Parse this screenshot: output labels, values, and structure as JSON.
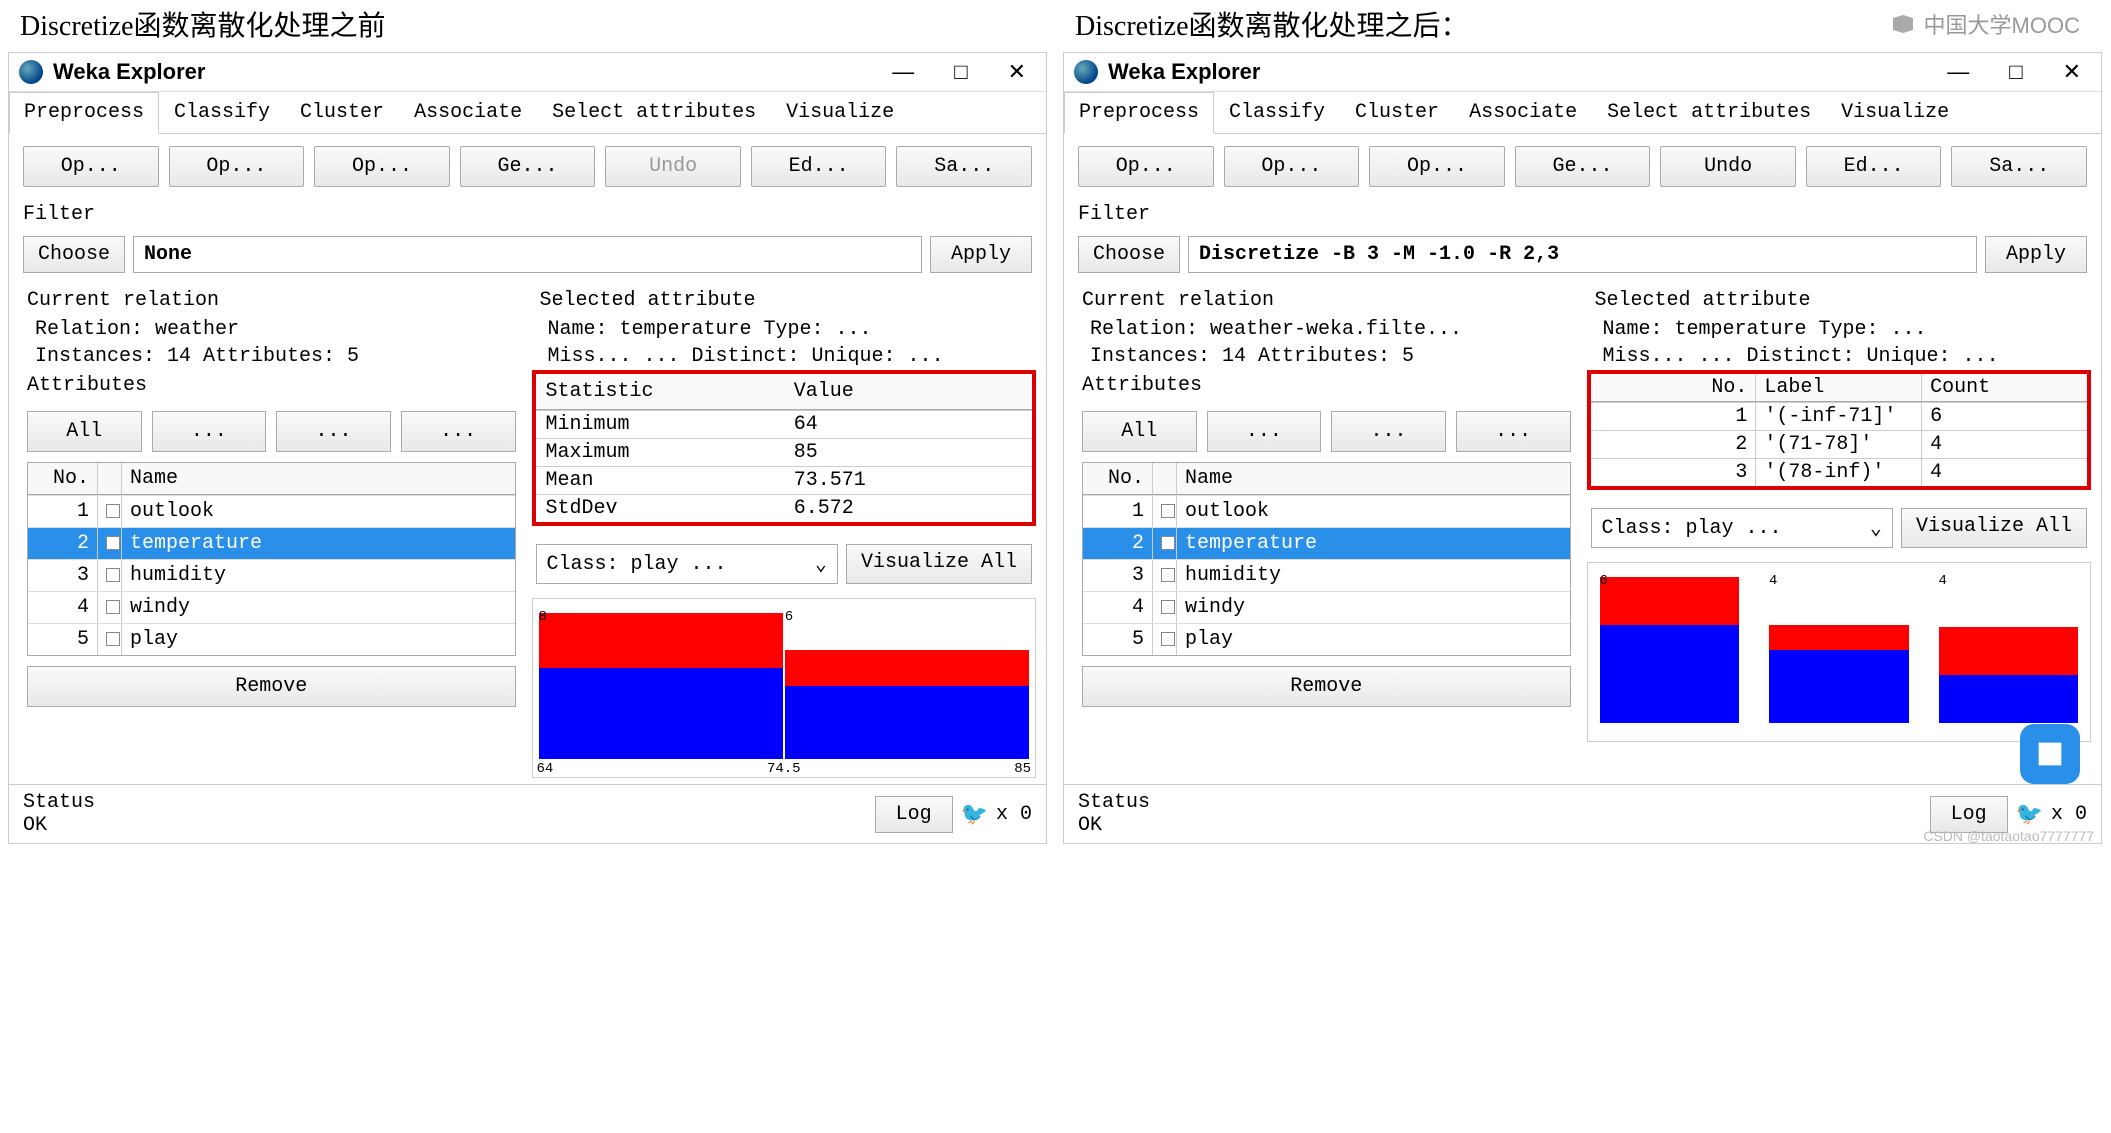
{
  "page_titles": {
    "before": "Discretize函数离散化处理之前",
    "after": "Discretize函数离散化处理之后：",
    "mooc": "中国大学MOOC"
  },
  "watermark": "CSDN @taotaotao7777777",
  "window_title": "Weka Explorer",
  "win_buttons": {
    "min": "—",
    "max": "□",
    "close": "✕"
  },
  "tabs": [
    "Preprocess",
    "Classify",
    "Cluster",
    "Associate",
    "Select attributes",
    "Visualize"
  ],
  "toolbar": [
    "Op...",
    "Op...",
    "Op...",
    "Ge...",
    "Undo",
    "Ed...",
    "Sa..."
  ],
  "filter_label": "Filter",
  "choose_label": "Choose",
  "apply_label": "Apply",
  "filter_value_before": "None",
  "filter_value_after": "Discretize -B 3 -M -1.0 -R 2,3",
  "relation_title": "Current relation",
  "relation_before": "Relation: weather",
  "relation_after": "Relation: weather-weka.filte...",
  "instances_line": "Instances: 14    Attributes: 5",
  "attributes_title": "Attributes",
  "attr_btns": [
    "All",
    "...",
    "...",
    "..."
  ],
  "attr_header": {
    "no": "No.",
    "name": "Name"
  },
  "attributes": [
    {
      "no": 1,
      "name": "outlook"
    },
    {
      "no": 2,
      "name": "temperature",
      "selected": true
    },
    {
      "no": 3,
      "name": "humidity"
    },
    {
      "no": 4,
      "name": "windy"
    },
    {
      "no": 5,
      "name": "play"
    }
  ],
  "remove_label": "Remove",
  "selected_attr_title": "Selected attribute",
  "selected_lines": [
    "Name: temperature     Type: ...",
    "Miss... ...  Distinct:  Unique: ..."
  ],
  "stat_header_before": [
    "Statistic",
    "Value"
  ],
  "stats_before": [
    [
      "Minimum",
      "64"
    ],
    [
      "Maximum",
      "85"
    ],
    [
      "Mean",
      "73.571"
    ],
    [
      "StdDev",
      "6.572"
    ]
  ],
  "stat_header_after": [
    "No.",
    "Label",
    "Count"
  ],
  "stats_after": [
    [
      "1",
      "'(-inf-71]'",
      "6"
    ],
    [
      "2",
      "'(71-78]'",
      "4"
    ],
    [
      "3",
      "'(78-inf)'",
      "4"
    ]
  ],
  "class_select": "Class: play ...",
  "visualize_all": "Visualize All",
  "chart_data": [
    {
      "type": "bar",
      "title": "",
      "x": [
        64,
        74.5,
        85
      ],
      "x_ticks": [
        "64",
        "74.5",
        "85"
      ],
      "bars": [
        {
          "label": "8",
          "total": 8,
          "blue": 5,
          "red": 3
        },
        {
          "label": "6",
          "total": 6,
          "blue": 4,
          "red": 2
        }
      ]
    },
    {
      "type": "bar",
      "title": "",
      "categories": [
        "'(-inf-71]'",
        "'(71-78]'",
        "'(78-inf)'"
      ],
      "bars": [
        {
          "label": "6",
          "total": 6,
          "blue": 4,
          "red": 2
        },
        {
          "label": "4",
          "total": 4,
          "blue": 3,
          "red": 1
        },
        {
          "label": "4",
          "total": 4,
          "blue": 2,
          "red": 2
        }
      ]
    }
  ],
  "status_label": "Status",
  "status_value": "OK",
  "log_label": "Log",
  "x0": "x 0"
}
